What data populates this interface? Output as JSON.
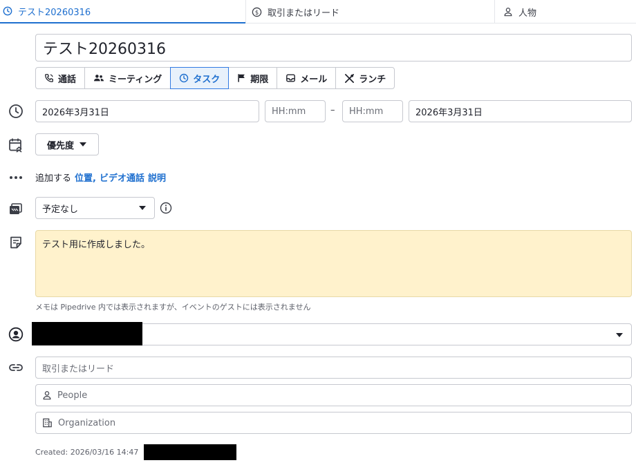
{
  "tabs": {
    "activity": "テスト20260316",
    "deal": "取引またはリード",
    "person": "人物"
  },
  "subject": "テスト20260316",
  "types": [
    {
      "label": "通話",
      "icon": "phone-icon"
    },
    {
      "label": "ミーティング",
      "icon": "people-icon"
    },
    {
      "label": "タスク",
      "icon": "clock-icon"
    },
    {
      "label": "期限",
      "icon": "flag-icon"
    },
    {
      "label": "メール",
      "icon": "inbox-icon"
    },
    {
      "label": "ランチ",
      "icon": "cutlery-icon"
    }
  ],
  "selected_type": "タスク",
  "schedule": {
    "start_date": "2026年3月31日",
    "start_time_placeholder": "HH:mm",
    "separator": "–",
    "end_time_placeholder": "HH:mm",
    "end_date": "2026年3月31日"
  },
  "priority": {
    "label": "優先度"
  },
  "add_more": {
    "prefix": "追加する",
    "location": "位置,",
    "video": "ビデオ通話",
    "description": "説明"
  },
  "availability": {
    "value": "予定なし"
  },
  "note": {
    "text": "テスト用に作成しました。",
    "hint": "メモは Pipedrive 内では表示されますが、イベントのゲストには表示されません"
  },
  "links": {
    "deal_placeholder": "取引またはリード",
    "people_placeholder": "People",
    "organization_placeholder": "Organization"
  },
  "footer": {
    "created": "Created: 2026/03/16 14:47"
  },
  "colors": {
    "accent": "#1e6fcf",
    "note_bg": "#fff2cc",
    "redaction": "#000000"
  }
}
